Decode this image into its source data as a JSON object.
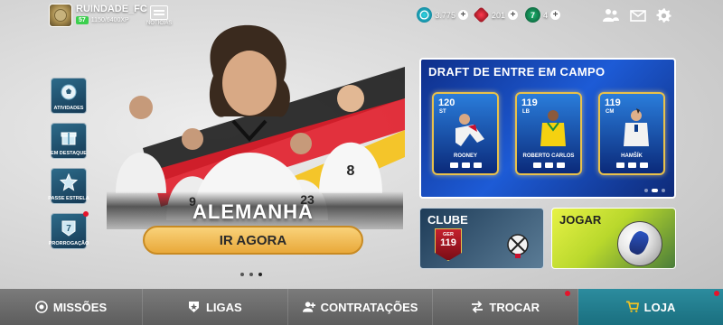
{
  "profile": {
    "username": "RUINDADE_FC",
    "level": "57",
    "xp": "1150/6400XP"
  },
  "news": {
    "label": "NOTÍCIAS",
    "icon": "newspaper-icon"
  },
  "currencies": [
    {
      "name": "coins",
      "value": "3.775",
      "icon": "coin-icon",
      "color": "#1fb7cf"
    },
    {
      "name": "gems",
      "value": "201",
      "icon": "gem-icon",
      "color": "#e52a3c"
    },
    {
      "name": "tokens",
      "value": "4",
      "icon": "token-icon",
      "color": "#17a664"
    }
  ],
  "top_icons": [
    "friends-icon",
    "mail-icon",
    "gear-icon"
  ],
  "side_menu": [
    {
      "label": "ATIVIDADES",
      "icon": "ball-icon"
    },
    {
      "label": "EM DESTAQUE",
      "icon": "gift-icon"
    },
    {
      "label": "PASSE ESTRELA",
      "icon": "star-icon"
    },
    {
      "label": "PRORROGAÇÃO",
      "icon": "seven-badge-icon",
      "badge": true
    }
  ],
  "hero": {
    "title": "ALEMANHA",
    "cta": "IR AGORA",
    "player_numbers": [
      "9",
      "23",
      "8"
    ]
  },
  "draft": {
    "title": "DRAFT DE ENTRE EM CAMPO",
    "cards": [
      {
        "ovr": "120",
        "pos": "ST",
        "name": "ROONEY"
      },
      {
        "ovr": "119",
        "pos": "LB",
        "name": "ROBERTO CARLOS"
      },
      {
        "ovr": "119",
        "pos": "CM",
        "name": "HAMŠÍK"
      }
    ]
  },
  "club": {
    "title": "CLUBE",
    "badge_top": "GER",
    "badge_value": "119"
  },
  "play": {
    "title": "JOGAR"
  },
  "bottom_nav": [
    {
      "label": "MISSÕES",
      "icon": "target-icon"
    },
    {
      "label": "LIGAS",
      "icon": "shield-icon"
    },
    {
      "label": "CONTRATAÇÕES",
      "icon": "signing-icon"
    },
    {
      "label": "TROCAR",
      "icon": "swap-icon"
    },
    {
      "label": "LOJA",
      "icon": "cart-icon",
      "active": true
    }
  ],
  "colors": {
    "accent_gold": "#e9a93a",
    "active_tab": "#1a6f7f",
    "notification": "#e5142b"
  }
}
